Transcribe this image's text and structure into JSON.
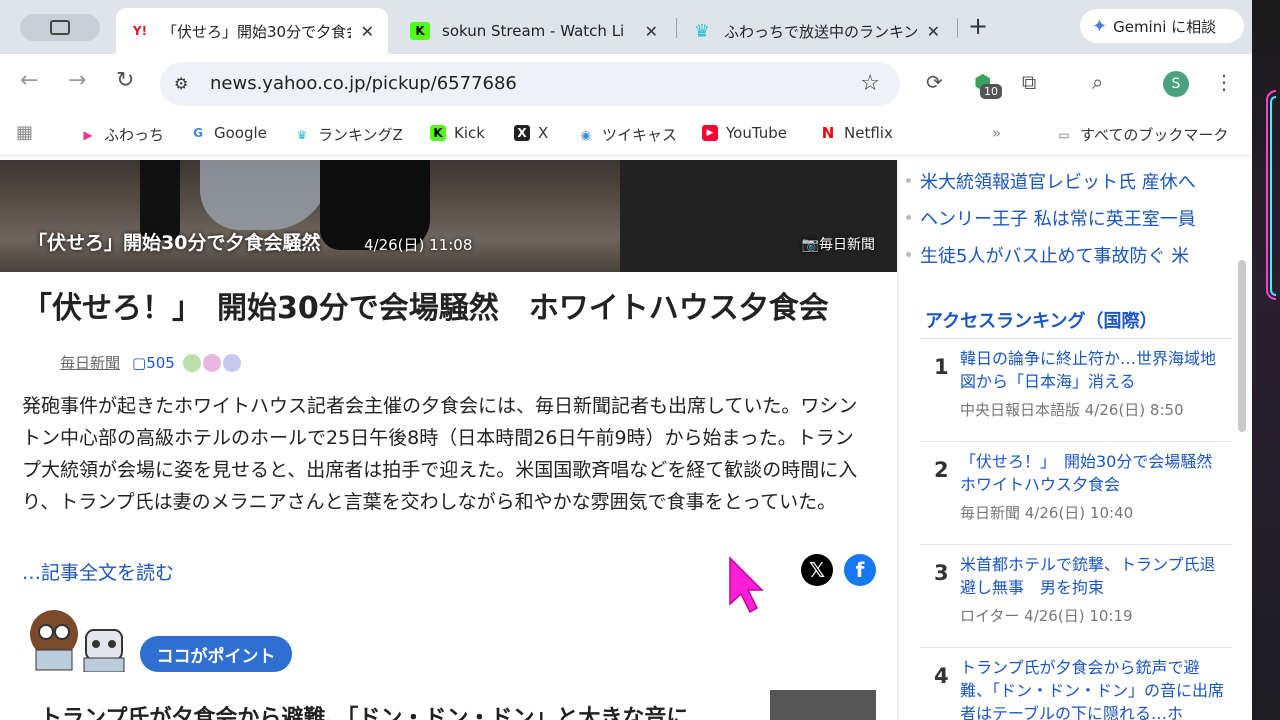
{
  "browser": {
    "tabs": [
      {
        "title": "「伏せろ」開始30分で夕食会",
        "favicon": "Y!"
      },
      {
        "title": "sokun Stream - Watch Li",
        "favicon": "K"
      },
      {
        "title": "ふわっちで放送中のランキン",
        "favicon": "crown-icon"
      }
    ],
    "gemini_label": "Gemini に相談",
    "url": "news.yahoo.co.jp/pickup/6577686",
    "extension_badge": "10",
    "profile_initial": "S",
    "bookmarks": [
      "ふわっち",
      "Google",
      "ランキングZ",
      "Kick",
      "X",
      "ツイキャス",
      "YouTube",
      "Netflix"
    ],
    "all_bookmarks_label": "すべてのブックマーク"
  },
  "article": {
    "hero_caption": "「伏せろ」開始30分で夕食会騒然",
    "hero_date": "4/26(日) 11:08",
    "hero_source": "毎日新聞",
    "title": "「伏せろ！」　開始30分で会場騒然　ホワイトハウス夕食会",
    "source": "毎日新聞",
    "comment_count": "505",
    "body": "発砲事件が起きたホワイトハウス記者会主催の夕食会には、毎日新聞記者も出席していた。ワシントン中心部の高級ホテルのホールで25日午後8時（日本時間26日午前9時）から始まった。トランプ大統領が会場に姿を見せると、出席者は拍手で迎えた。米国国歌斉唱などを経て歓談の時間に入り、トランプ氏は妻のメラニアさんと言葉を交わしながら和やかな雰囲気で食事をとっていた。",
    "read_more": "…記事全文を読む",
    "point_label": "ココがポイント",
    "sub_headline": "トランプ氏が夕食会から避難、「ドン・ドン・ドン」と大きな音に"
  },
  "sidebar": {
    "related_links": [
      "米大統領報道官レビット氏 産休へ",
      "ヘンリー王子 私は常に英王室一員",
      "生徒5人がバス止めて事故防ぐ 米"
    ],
    "ranking_title": "アクセスランキング（国際）",
    "ranking": [
      {
        "rank": "1",
        "title": "韓日の論争に終止符か…世界海域地図から「日本海」消える",
        "meta": "中央日報日本語版 4/26(日) 8:50"
      },
      {
        "rank": "2",
        "title": "「伏せろ！」　開始30分で会場騒然　ホワイトハウス夕食会",
        "meta": "毎日新聞 4/26(日) 10:40"
      },
      {
        "rank": "3",
        "title": "米首都ホテルで銃撃、トランプ氏退避し無事　男を拘束",
        "meta": "ロイター 4/26(日) 10:19"
      },
      {
        "rank": "4",
        "title": "トランプ氏が夕食会から銃声で避難、「ドン・ドン・ドン」の音に出席者はテーブルの下に隠れる…ホ",
        "meta": ""
      }
    ]
  },
  "colors": {
    "link": "#1a56c2",
    "accent_button": "#2f6fd1"
  }
}
